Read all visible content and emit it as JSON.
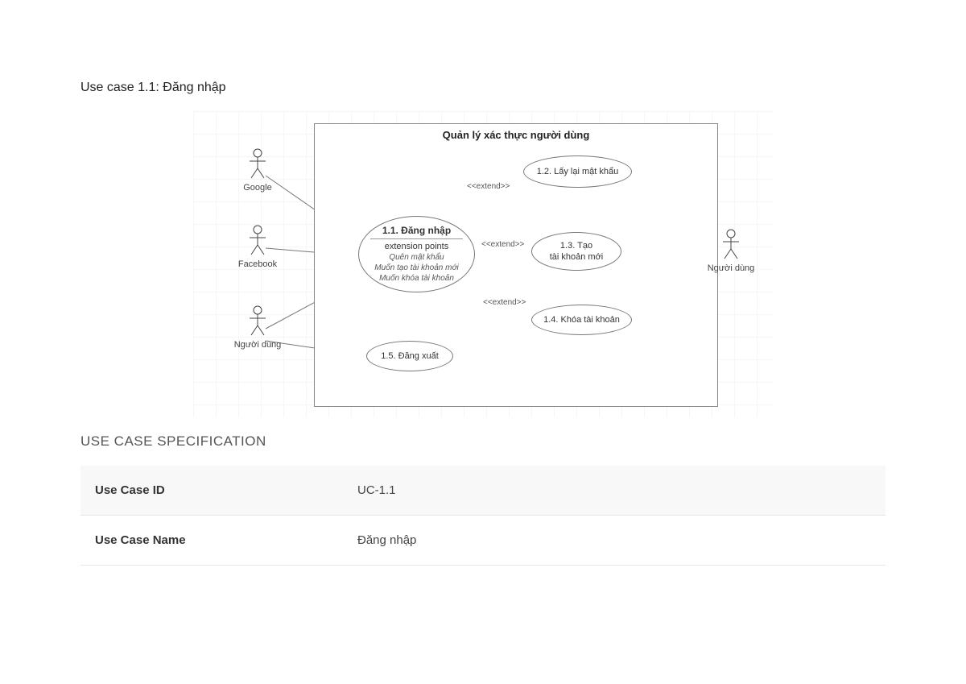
{
  "page_title": "Use case 1.1: Đăng nhập",
  "diagram": {
    "system_title": "Quản lý xác thực người dùng",
    "actors_left": [
      "Google",
      "Facebook",
      "Người dùng"
    ],
    "actor_right": "Người dùng",
    "main_uc": {
      "title": "1.1. Đăng nhập",
      "ext_pts_label": "extension points",
      "ext_points": [
        "Quên mật khẩu",
        "Muốn tạo tài khoản mới",
        "Muốn khóa tài khoản"
      ]
    },
    "uc_12": "1.2. Lấy lại mật khẩu",
    "uc_13_a": "1.3. Tạo",
    "uc_13_b": "tài khoản mới",
    "uc_14": "1.4. Khóa tài khoản",
    "uc_15": "1.5. Đăng xuất",
    "extend_label": "<<extend>>"
  },
  "spec_heading": "USE CASE SPECIFICATION",
  "spec": [
    {
      "k": "Use Case ID",
      "v": "UC-1.1"
    },
    {
      "k": "Use Case Name",
      "v": "Đăng nhập"
    }
  ]
}
